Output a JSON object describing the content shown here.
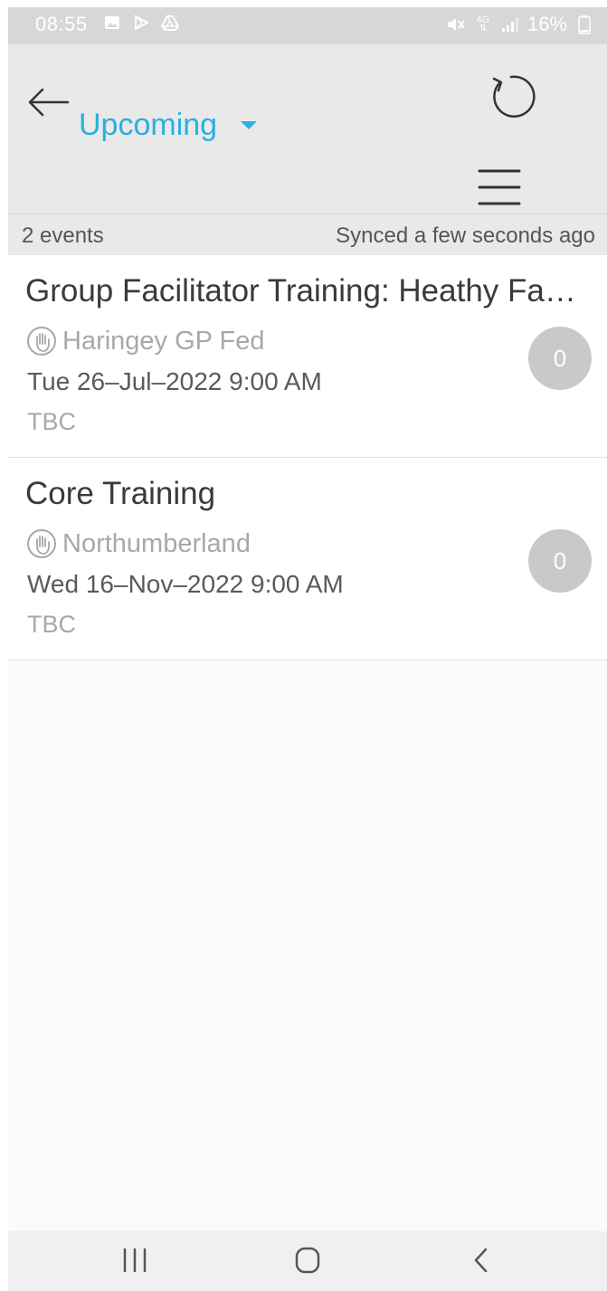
{
  "status_bar": {
    "time": "08:55",
    "battery": "16%",
    "icons": [
      "gallery-icon",
      "play-store-icon",
      "drive-icon",
      "mute-icon",
      "network-4g-icon",
      "signal-icon",
      "battery-icon"
    ]
  },
  "header": {
    "view_selector": "Upcoming",
    "accent_color": "#29b1e0",
    "icons": [
      "back-arrow-icon",
      "refresh-icon",
      "hamburger-menu-icon",
      "dropdown-caret-icon"
    ]
  },
  "info_bar": {
    "event_count": "2 events",
    "sync_status": "Synced a few seconds ago"
  },
  "events": [
    {
      "title": "Group Facilitator Training: Heathy Fa…",
      "organization": "Haringey GP Fed",
      "date": "Tue 26–Jul–2022 9:00 AM",
      "location": "TBC",
      "count": "0"
    },
    {
      "title": "Core Training",
      "organization": "Northumberland",
      "date": "Wed 16–Nov–2022 9:00 AM",
      "location": "TBC",
      "count": "0"
    }
  ],
  "nav_bar": {
    "icons": [
      "recent-apps-icon",
      "home-icon",
      "back-icon"
    ]
  }
}
